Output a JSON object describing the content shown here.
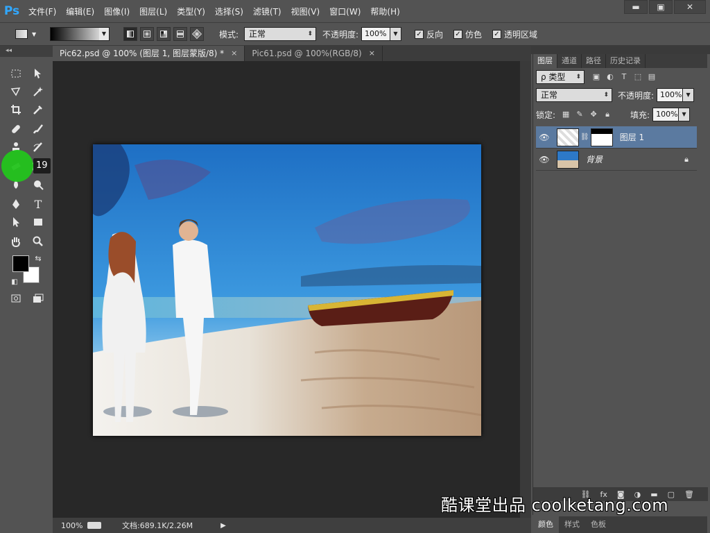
{
  "app": {
    "logo": "Ps"
  },
  "menu": [
    "文件(F)",
    "编辑(E)",
    "图像(I)",
    "图层(L)",
    "类型(Y)",
    "选择(S)",
    "滤镜(T)",
    "视图(V)",
    "窗口(W)",
    "帮助(H)"
  ],
  "window_controls": {
    "minimize": "▬",
    "maximize": "▣",
    "close": "✕"
  },
  "options": {
    "mode_label": "模式:",
    "mode_value": "正常",
    "opacity_label": "不透明度:",
    "opacity_value": "100%",
    "reverse_label": "反向",
    "dither_label": "仿色",
    "transparency_label": "透明区域"
  },
  "tabs": [
    {
      "label": "Pic62.psd @ 100% (图层 1, 图层蒙版/8) *",
      "close": "×"
    },
    {
      "label": "Pic61.psd @ 100%(RGB/8)",
      "close": "×"
    }
  ],
  "status": {
    "zoom": "100%",
    "doc_info": "文档:689.1K/2.26M",
    "play": "▶"
  },
  "brush_size": "19",
  "colors": {
    "foreground": "#000000",
    "background": "#ffffff",
    "accent": "#31a8ff",
    "cursor": "#23c41c",
    "selected_layer": "#5b7aa0"
  },
  "panels": {
    "tabs": [
      "图层",
      "通道",
      "路径",
      "历史记录"
    ],
    "filter_label": "ρ 类型",
    "blend_mode": "正常",
    "opacity_label": "不透明度:",
    "opacity_value": "100%",
    "lock_label": "锁定:",
    "fill_label": "填充:",
    "fill_value": "100%",
    "layers": [
      {
        "name": "图层 1",
        "visible": true,
        "selected": true
      },
      {
        "name": "背景",
        "visible": true,
        "locked": true
      }
    ],
    "bottom_tabs": [
      "颜色",
      "样式",
      "色板"
    ]
  },
  "watermark": "酷课堂出品 coolketang.com"
}
